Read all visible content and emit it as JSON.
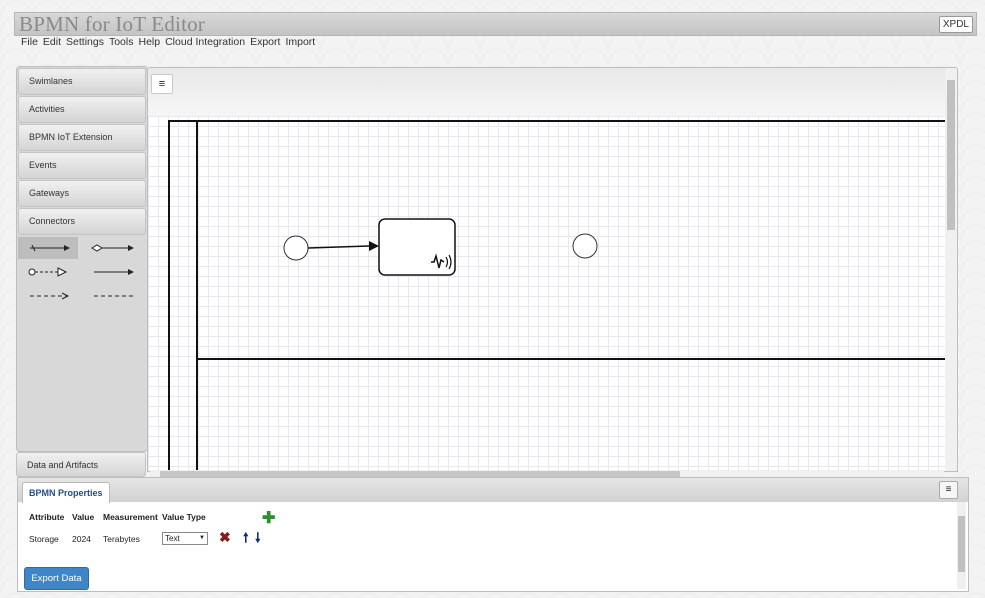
{
  "app": {
    "title": "BPMN for IoT Editor",
    "xpdl_label": "XPDL"
  },
  "menu": [
    "File",
    "Edit",
    "Settings",
    "Tools",
    "Help",
    "Cloud Integration",
    "Export",
    "Import"
  ],
  "palette": {
    "sections": [
      "Swimlanes",
      "Activities",
      "BPMN IoT Extension",
      "Events",
      "Gateways",
      "Connectors"
    ],
    "bottom_section": "Data and Artifacts",
    "connector_tools": [
      "sequence-flow-icon",
      "association-diamond-icon",
      "message-flow-icon",
      "plain-arrow-icon",
      "dashed-arrow-icon",
      "dashed-line-icon"
    ]
  },
  "canvas": {
    "toolbar_icon": "outline-icon",
    "elements": [
      "start-event",
      "iot-task",
      "end-event"
    ],
    "task_icon": "iot-sensor-icon"
  },
  "properties": {
    "tab_label": "BPMN Properties",
    "headers": [
      "Attribute",
      "Value",
      "Measurement",
      "Value Type"
    ],
    "rows": [
      {
        "attribute": "Storage",
        "value": "2024",
        "measurement": "Terabytes",
        "value_type": "Text"
      }
    ],
    "export_label": "Export Data"
  },
  "colors": {
    "accent": "#3f86c8",
    "add": "#2f8f2f",
    "delete": "#8b1a1a",
    "move": "#0b2a80"
  }
}
